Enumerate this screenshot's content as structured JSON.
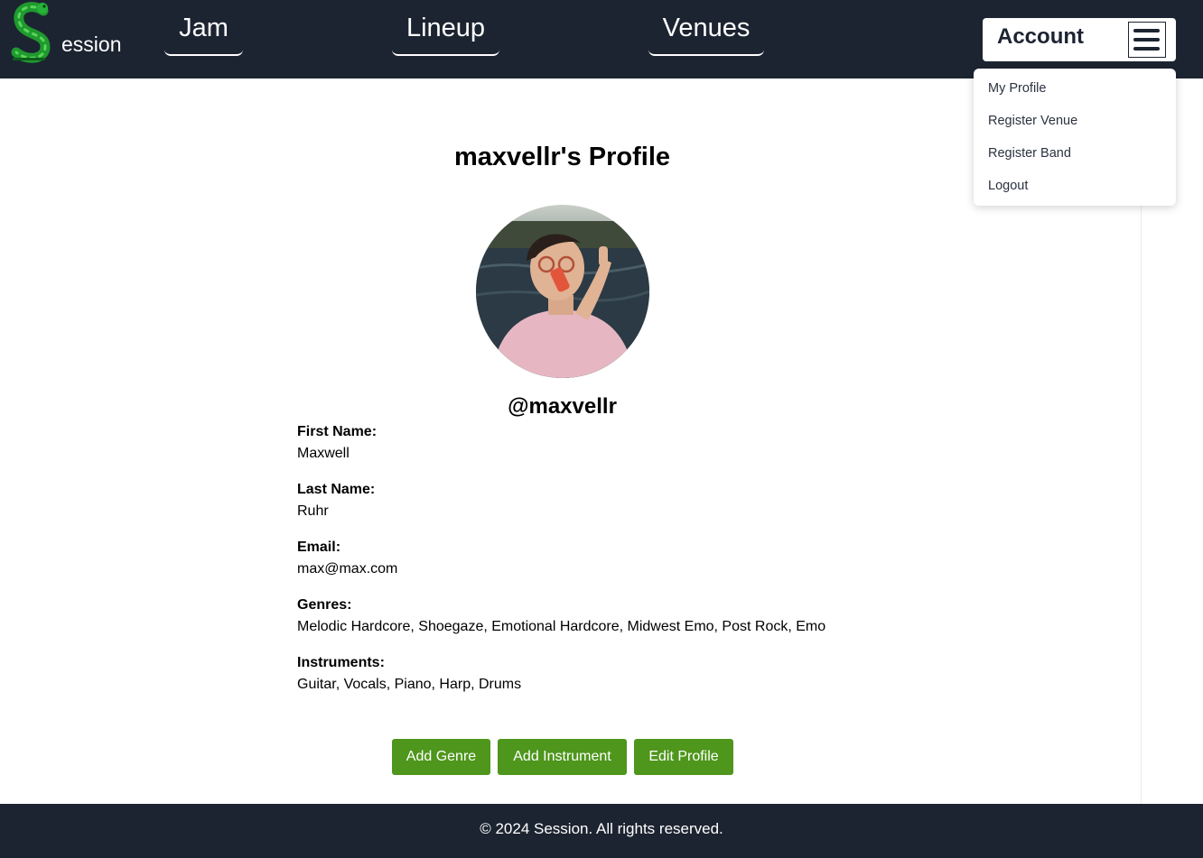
{
  "brand": {
    "logo_text": "ession"
  },
  "nav": {
    "jam": "Jam",
    "lineup": "Lineup",
    "venues": "Venues"
  },
  "account": {
    "label": "Account",
    "menu": [
      "My Profile",
      "Register Venue",
      "Register Band",
      "Logout"
    ]
  },
  "profile": {
    "title": "maxvellr's Profile",
    "username": "@maxvellr",
    "fields": [
      {
        "label": "First Name:",
        "value": "Maxwell"
      },
      {
        "label": "Last Name:",
        "value": "Ruhr"
      },
      {
        "label": "Email:",
        "value": "max@max.com"
      },
      {
        "label": "Genres:",
        "value": "Melodic Hardcore, Shoegaze, Emotional Hardcore, Midwest Emo, Post Rock, Emo"
      },
      {
        "label": "Instruments:",
        "value": "Guitar, Vocals, Piano, Harp, Drums"
      }
    ]
  },
  "actions": {
    "add_genre": "Add Genre",
    "add_instrument": "Add Instrument",
    "edit_profile": "Edit Profile"
  },
  "footer": {
    "copyright": "© 2024 Session. All rights reserved."
  },
  "colors": {
    "nav_bg": "#1c2431",
    "accent_green": "#4e961c",
    "logo_green": "#1f9a2e"
  },
  "icons": {
    "logo": "green-worm-s-logo-icon",
    "menu": "hamburger-menu-icon"
  }
}
